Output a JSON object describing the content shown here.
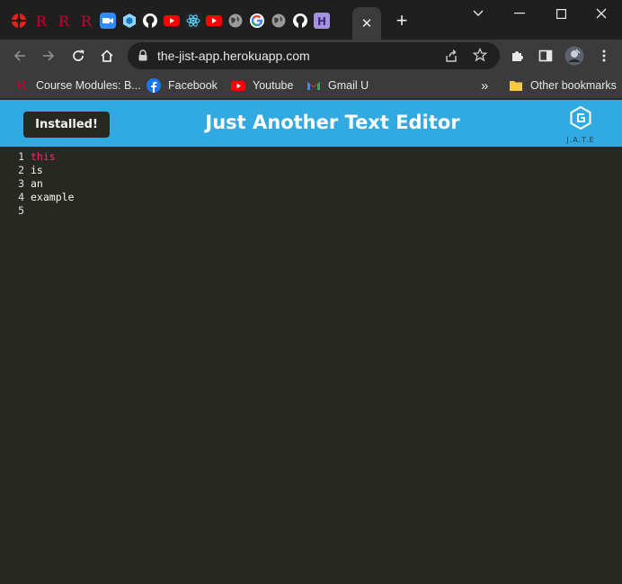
{
  "browser": {
    "tabs": [
      {
        "icon": "game-icon",
        "color": "#e2231a"
      },
      {
        "icon": "rutgers-r-icon",
        "color": "#cc0033"
      },
      {
        "icon": "rutgers-r-icon",
        "color": "#cc0033"
      },
      {
        "icon": "rutgers-r-icon",
        "color": "#cc0033"
      },
      {
        "icon": "zoom-icon",
        "color": "#2d8cff"
      },
      {
        "icon": "webpack-icon",
        "color": "#8ed6fb"
      },
      {
        "icon": "github-icon",
        "color": "#ffffff"
      },
      {
        "icon": "youtube-icon",
        "color": "#ff0000"
      },
      {
        "icon": "react-icon",
        "color": "#61dafb"
      },
      {
        "icon": "youtube-icon",
        "color": "#ff0000"
      },
      {
        "icon": "globe-icon",
        "color": "#cfcfcf"
      },
      {
        "icon": "google-icon",
        "color": "#4285f4"
      },
      {
        "icon": "globe-icon",
        "color": "#cfcfcf"
      },
      {
        "icon": "github-icon",
        "color": "#ffffff"
      },
      {
        "icon": "heroku-icon",
        "color": "#a593e0"
      }
    ],
    "active_tab_close": "✕",
    "new_tab": "+",
    "url": "the-jist-app.herokuapp.com",
    "bookmarks": [
      {
        "icon": "rutgers-r-icon",
        "label": "Course Modules: B..."
      },
      {
        "icon": "facebook-icon",
        "label": "Facebook"
      },
      {
        "icon": "youtube-icon",
        "label": "Youtube"
      },
      {
        "icon": "gmail-icon",
        "label": "Gmail U"
      }
    ],
    "overflow": "»",
    "other_bookmarks": "Other bookmarks"
  },
  "app": {
    "install_label": "Installed!",
    "title": "Just Another Text Editor",
    "logo_text": "J.A.T.E",
    "header_color": "#31a9e1",
    "editor_bg": "#272822"
  },
  "editor": {
    "lines": [
      {
        "num": "1",
        "text": "this"
      },
      {
        "num": "2",
        "text": "is"
      },
      {
        "num": "3",
        "text": "an"
      },
      {
        "num": "4",
        "text": "example"
      },
      {
        "num": "5",
        "text": ""
      }
    ]
  }
}
